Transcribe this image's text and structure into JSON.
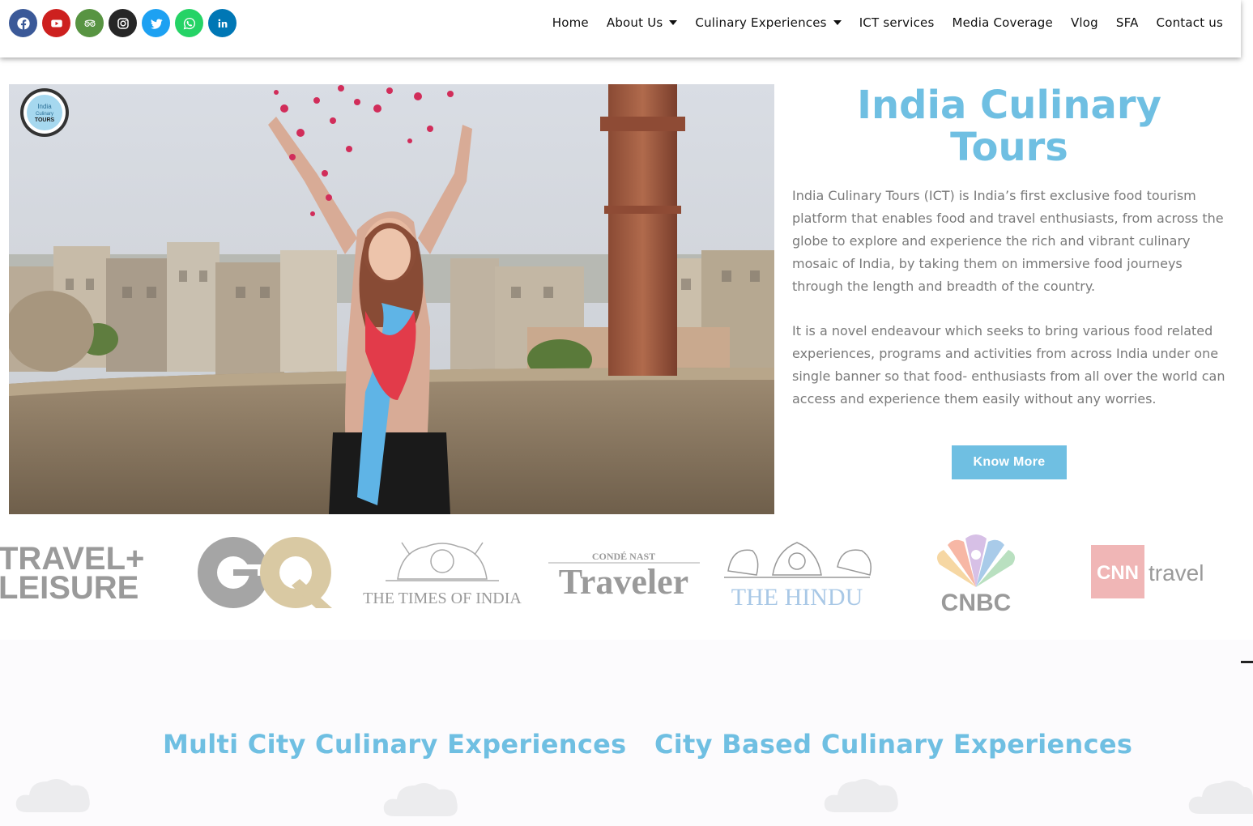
{
  "header": {
    "social": [
      {
        "name": "facebook",
        "glyph": "f",
        "color": "#3b5998"
      },
      {
        "name": "youtube",
        "glyph": "▶",
        "color": "#cd201f"
      },
      {
        "name": "tripadvisor",
        "glyph": "oo",
        "color": "#589442"
      },
      {
        "name": "instagram",
        "glyph": "◎",
        "color": "#262626"
      },
      {
        "name": "twitter",
        "glyph": "t",
        "color": "#1da1f2"
      },
      {
        "name": "whatsapp",
        "glyph": "✆",
        "color": "#25d366"
      },
      {
        "name": "linkedin",
        "glyph": "in",
        "color": "#0077b5"
      }
    ],
    "nav": {
      "home": "Home",
      "about": "About Us",
      "culinary": "Culinary Experiences",
      "ict": "ICT services",
      "media": "Media Coverage",
      "vlog": "Vlog",
      "sfa": "SFA",
      "contact": "Contact us"
    }
  },
  "hero": {
    "logo_text": [
      "India",
      "Culinary",
      "TOURS"
    ],
    "title": "India Culinary Tours",
    "paragraph1": "India Culinary Tours (ICT) is India’s first exclusive food tourism platform that enables food and travel enthusiasts, from across the globe to explore and experience the rich and vibrant culinary mosaic of India, by taking them on immersive food journeys through the length and breadth of the country.",
    "paragraph2": "It is a novel endeavour which seeks to bring various food related experiences, programs and activities from across India under one single banner so that food- enthusiasts from all over the world can access and experience them easily without any worries.",
    "button": "Know More"
  },
  "media_logos": {
    "travel_leisure": [
      "TRAVEL+",
      "LEISURE"
    ],
    "gq": "GQ",
    "toi": "THE TIMES OF INDIA",
    "conde_top": "CONDÉ NAST",
    "conde_main": "Traveler",
    "hindu": "THE HINDU",
    "cnbc": "CNBC",
    "cnn": "CNN",
    "cnn_travel": "travel"
  },
  "sections": {
    "multi_city": "Multi City Culinary Experiences",
    "city_based": "City Based Culinary Experiences"
  },
  "colors": {
    "accent": "#6fbfe2",
    "text_gray": "#7a7a7a"
  }
}
